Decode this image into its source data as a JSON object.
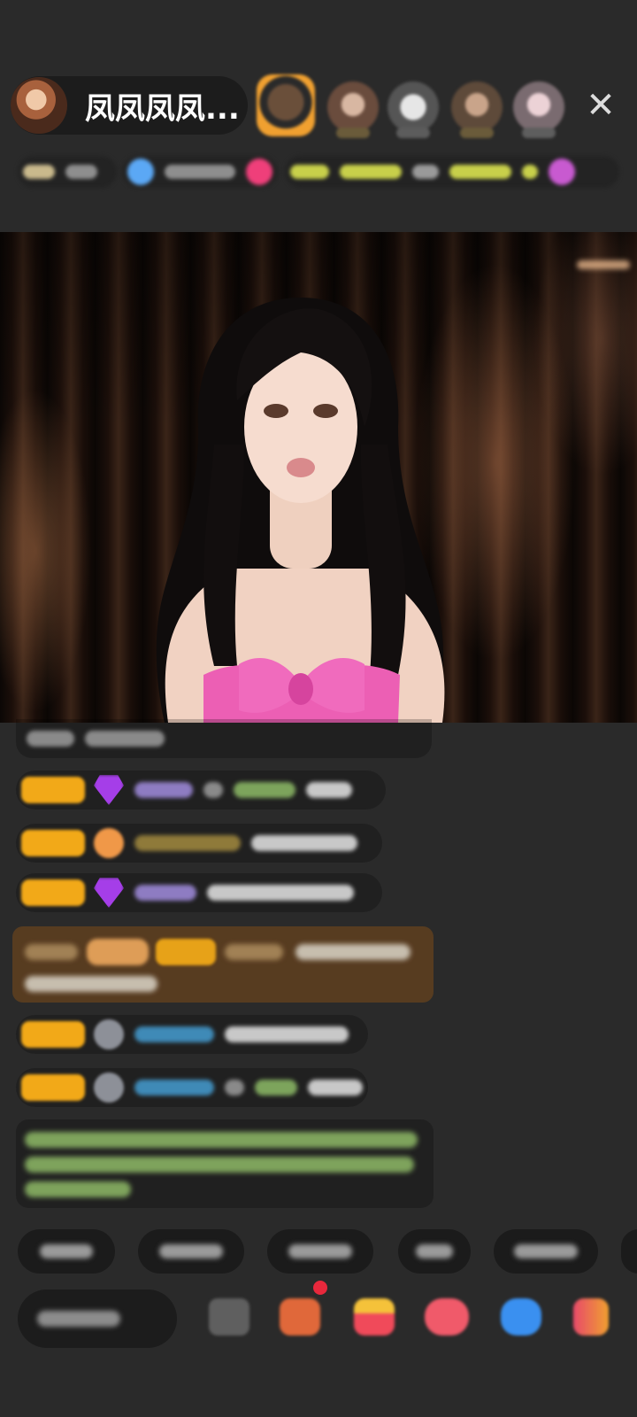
{
  "header": {
    "host_name": "凤凤凤凤...",
    "close_icon": "close-icon",
    "viewer_count": 5
  },
  "video": {
    "subject": "host-video-frame",
    "dress_color": "#ec5fb4"
  },
  "chat": {
    "messages_count": 8,
    "accent_level_color": "#f2a918",
    "highlight_color": "#5a3d20"
  },
  "quick_replies": {
    "count": 6
  },
  "bottom_bar": {
    "icons": [
      "emoji-icon",
      "gift-box-icon",
      "gift-bag-icon",
      "game-icon",
      "chat-bubble-icon",
      "more-icon"
    ]
  }
}
